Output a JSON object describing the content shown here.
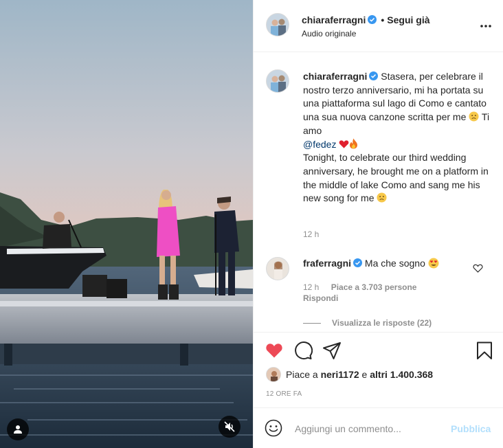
{
  "header": {
    "username": "chiaraferragni",
    "separator": "•",
    "follow_status": "Segui già",
    "audio": "Audio originale"
  },
  "caption": {
    "username": "chiaraferragni",
    "text_it": "Stasera, per celebrare il nostro terzo anniversario, mi ha portata su una piattaforma sul lago di Como e cantato una sua nuova canzone scritta per me",
    "ti_amo": "Ti amo",
    "mention": "@fedez",
    "text_en": "Tonight, to celebrate our third wedding anniversary, he brought me on a platform in the middle of lake Como and sang me his new song for me",
    "time": "12 h"
  },
  "comment": {
    "username": "fraferragni",
    "text": "Ma che sogno",
    "time": "12 h",
    "likes": "Piace a 3.703 persone",
    "reply": "Rispondi",
    "view_replies": "Visualizza le risposte (22)"
  },
  "likes": {
    "prefix": "Piace a",
    "user": "neri1172",
    "mid": "e",
    "others": "altri 1.400.368"
  },
  "post_time": "12 ORE FA",
  "composer": {
    "placeholder": "Aggiungi un commento...",
    "publish": "Pubblica"
  },
  "colors": {
    "like_red": "#ed4956",
    "verified_blue": "#3897f0",
    "mention": "#00376b",
    "publish_disabled": "#b2dffc",
    "secondary_text": "#8e8e8e"
  },
  "icons": {
    "like": "heart-filled-icon",
    "comment": "comment-bubble-icon",
    "share": "paper-plane-icon",
    "save": "bookmark-icon",
    "more": "ellipsis-icon",
    "mute": "speaker-muted-icon",
    "tag": "user-tag-icon",
    "emoji": "smiley-icon"
  }
}
